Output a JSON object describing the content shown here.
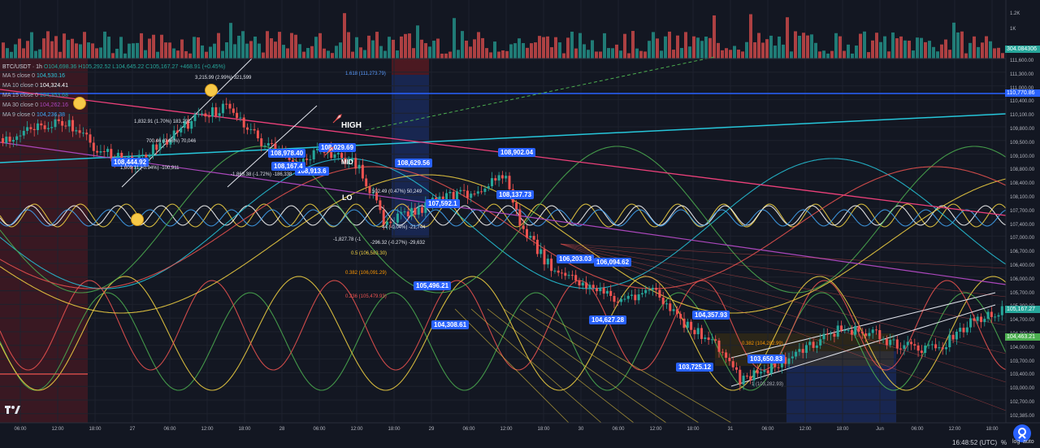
{
  "header": {
    "symbol": "BTC/USDT · 1h",
    "ohlc": "O104,698.36 H105,292.52 L104,645.22 C105,167.27 +468.91 (+0.45%)"
  },
  "indicators": [
    {
      "name": "MA 5 close 0",
      "value": "104,530.16",
      "color": "#26c6da"
    },
    {
      "name": "MA 10 close 0",
      "value": "104,324.41",
      "color": "#ffffff"
    },
    {
      "name": "MA 15 close 0",
      "value": "104,353.68",
      "color": "#26a69a"
    },
    {
      "name": "MA 30 close 0",
      "value": "104,262.16",
      "color": "#ab47bc"
    },
    {
      "name": "MA 9 close 0",
      "value": "104,236.38",
      "color": "#42a5f5"
    }
  ],
  "volume_axis": [
    "1.2K",
    "1K"
  ],
  "volume_tag": "304.084306",
  "price_axis": [
    "111,600.00",
    "111,300.00",
    "111,000.00",
    "110,400.00",
    "110,100.00",
    "109,800.00",
    "109,500.00",
    "109,100.00",
    "108,800.00",
    "108,400.00",
    "108,100.00",
    "107,700.00",
    "107,400.00",
    "107,000.00",
    "106,700.00",
    "106,400.00",
    "106,000.00",
    "105,700.00",
    "105,300.00",
    "104,700.00",
    "104,300.00",
    "104,000.00",
    "103,700.00",
    "103,400.00",
    "103,000.00",
    "102,700.00",
    "102,385.00"
  ],
  "price_tags": {
    "upper": "110,770.86",
    "current": "105,167.27",
    "lower": "104,463.21"
  },
  "time_axis": [
    "06:00",
    "12:00",
    "18:00",
    "27",
    "06:00",
    "12:00",
    "18:00",
    "28",
    "06:00",
    "12:00",
    "18:00",
    "29",
    "06:00",
    "12:00",
    "18:00",
    "30",
    "06:00",
    "12:00",
    "18:00",
    "31",
    "06:00",
    "12:00",
    "18:00",
    "Jun",
    "06:00",
    "12:00",
    "18:00"
  ],
  "chart_tags": [
    "108,902.04",
    "108,629.56",
    "108,444.92",
    "108,978.40",
    "108,029.69",
    "107,592.1",
    "108,137.73",
    "106,203.03",
    "106,094.62",
    "105,496.21",
    "104,627.28",
    "104,308.61",
    "104,357.93",
    "103,650.83",
    "103,725.12",
    "108,913.6",
    "108,167.4"
  ],
  "annotations": [
    "3,215.99 (2.99%) 321,599",
    "1,832.91 (1.70%) 183,291",
    "700.46 (0.66%) 70,046",
    "1,009.11 (-0.94%) -100,911",
    "-1,863.38 (-1.72%) -186,338",
    "502.49 (0.47%) 50,249",
    "-1,827.78 (-1",
    "-296.32 (-0.27%) -29,632",
    "44 (-0.04%) -21,744",
    "1.618 (111,273.79)",
    "0.5 (106,583.30)",
    "0.382 (106,091.29)",
    "0.236 (105,479.93)",
    "0.382 (104,282.99)",
    "1 (103,282.93)"
  ],
  "words": {
    "high": "HIGH",
    "mid": "MID",
    "low": "LO"
  },
  "footer": {
    "clock": "16:48:52 (UTC)",
    "percent": "%",
    "log": "log",
    "auto": "auto"
  },
  "colors": {
    "bg": "#131722",
    "up": "#26a69a",
    "down": "#ef5350",
    "accent": "#2962ff"
  },
  "icons": [
    "tradingview-logo-icon",
    "chart-settings-fab-icon"
  ]
}
